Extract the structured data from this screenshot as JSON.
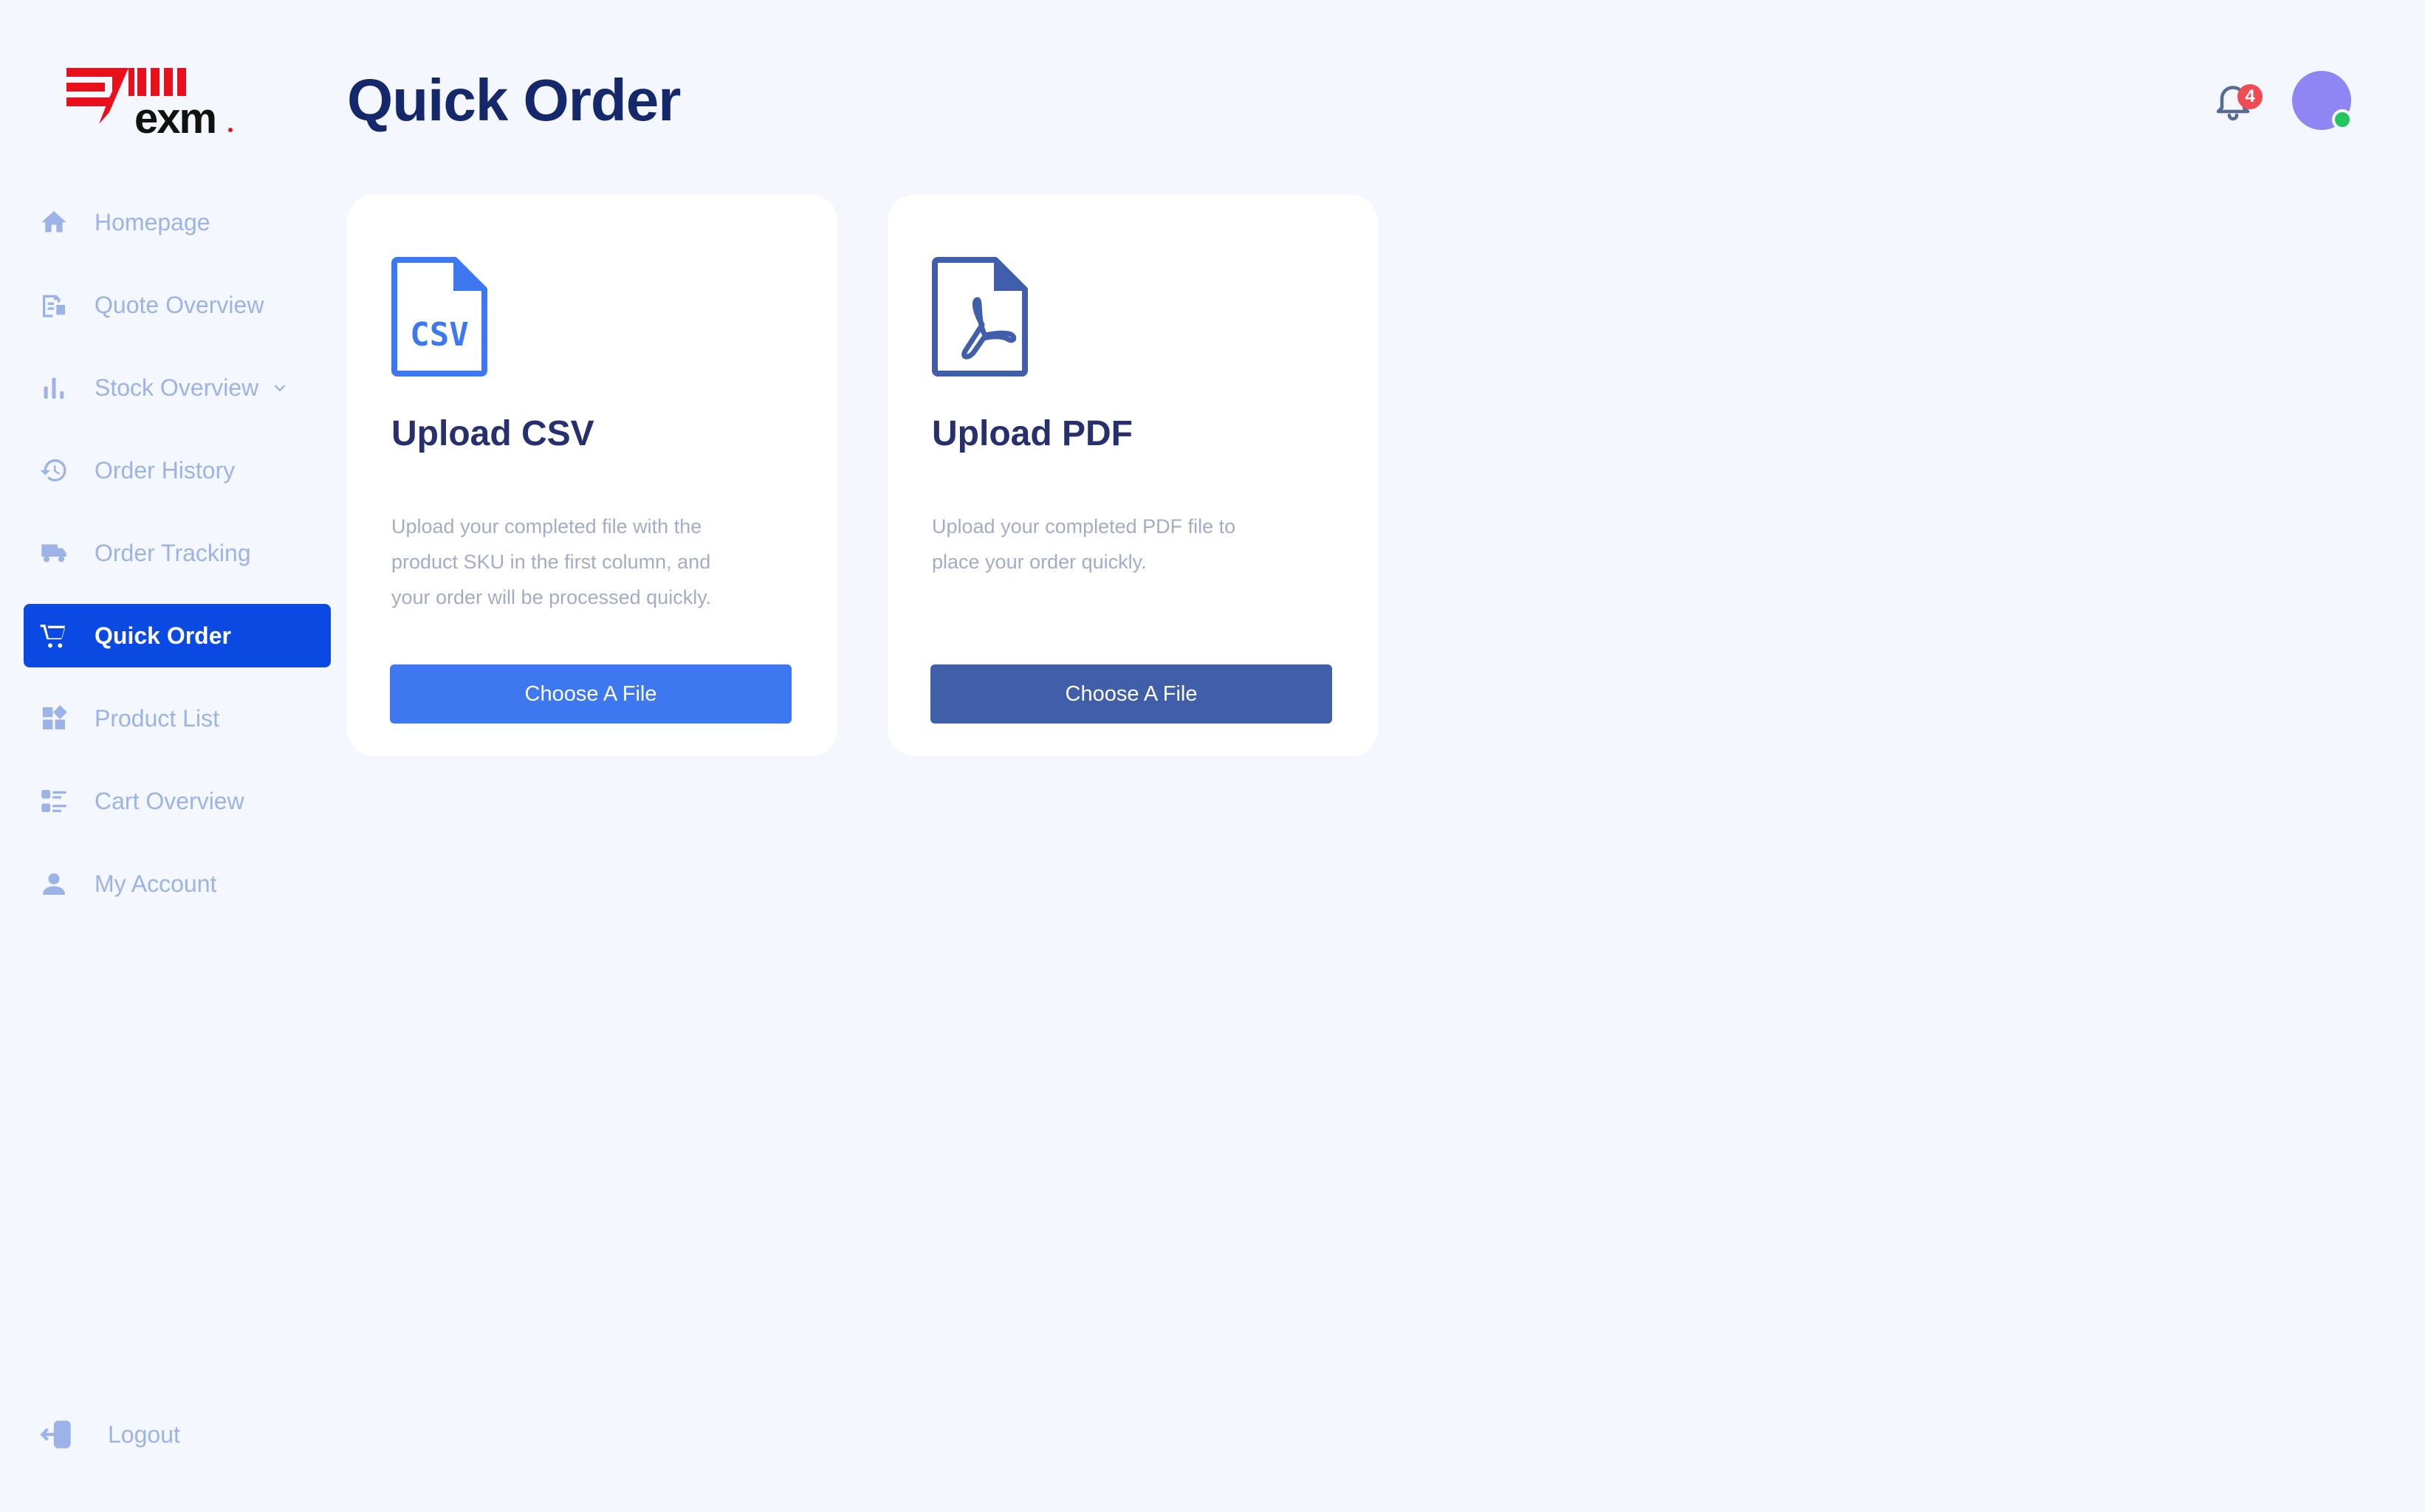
{
  "brand": {
    "logo_text": "exm"
  },
  "header": {
    "title": "Quick Order",
    "notification_count": "4"
  },
  "sidebar": {
    "items": [
      {
        "label": "Homepage",
        "icon": "home-icon"
      },
      {
        "label": "Quote Overview",
        "icon": "quote-icon"
      },
      {
        "label": "Stock Overview",
        "icon": "bar-chart-icon",
        "has_dropdown": true
      },
      {
        "label": "Order History",
        "icon": "history-icon"
      },
      {
        "label": "Order Tracking",
        "icon": "truck-icon"
      },
      {
        "label": "Quick Order",
        "icon": "cart-icon",
        "active": true
      },
      {
        "label": "Product List",
        "icon": "dashboard-icon"
      },
      {
        "label": "Cart Overview",
        "icon": "list-icon"
      },
      {
        "label": "My Account",
        "icon": "person-icon"
      }
    ],
    "logout_label": "Logout"
  },
  "cards": {
    "csv": {
      "icon_text": "CSV",
      "title": "Upload CSV",
      "description": "Upload your completed file with the product SKU in the first column, and your order will be processed quickly.",
      "button": "Choose A File"
    },
    "pdf": {
      "title": "Upload PDF",
      "description": "Upload your completed PDF file to place your order quickly.",
      "button": "Choose A File"
    }
  },
  "colors": {
    "background": "#f4f7fd",
    "active_nav": "#0b49e3",
    "nav_text": "#9cb3e8",
    "title": "#14286b",
    "csv_button": "#3d78f1",
    "pdf_button": "#405eaa",
    "logo_red": "#e8101a",
    "badge": "#ee4b55",
    "avatar": "#8f86f4",
    "online": "#22c55e"
  }
}
